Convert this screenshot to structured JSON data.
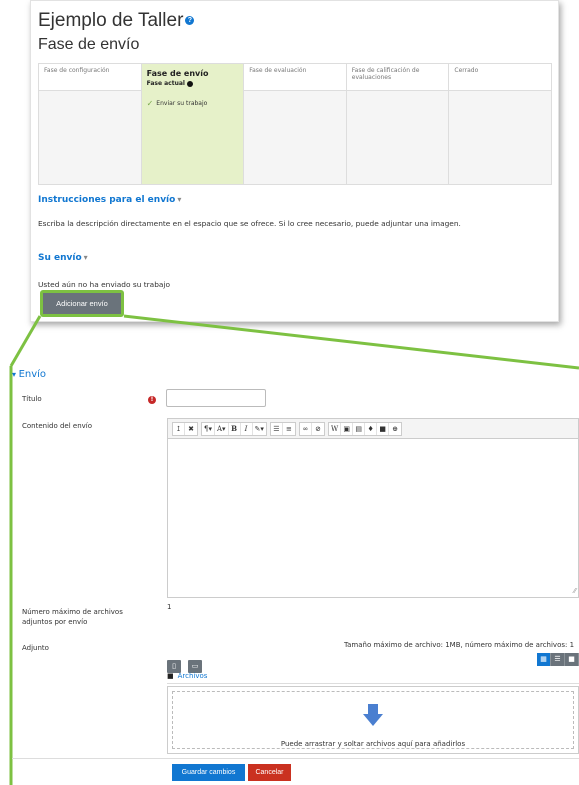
{
  "header": {
    "title": "Ejemplo de Taller",
    "help_glyph": "?",
    "phase_title": "Fase de envío"
  },
  "phases": [
    {
      "name": "Fase de configuración",
      "active": false
    },
    {
      "name": "Fase de envío",
      "active": true,
      "current_label": "Fase actual",
      "tasks": [
        "Enviar su trabajo"
      ]
    },
    {
      "name": "Fase de evaluación",
      "active": false
    },
    {
      "name": "Fase de calificación de evaluaciones",
      "active": false
    },
    {
      "name": "Cerrado",
      "active": false
    }
  ],
  "instructions": {
    "heading": "Instrucciones para el envío",
    "text": "Escriba la descripción directamente en el espacio que se ofrece. Si lo cree necesario, puede adjuntar una imagen."
  },
  "submission": {
    "heading": "Su envío",
    "status_text": "Usted aún no ha enviado su trabajo",
    "add_button": "Adicionar envío"
  },
  "form": {
    "legend": "Envío",
    "title_label": "Título",
    "title_value": "",
    "content_label": "Contenido del envío",
    "max_files_label": "Número máximo de archivos adjuntos por envío",
    "max_files_value": "1",
    "attachment_label": "Adjunto",
    "limits_text": "Tamaño máximo de archivo: 1MB, número máximo de archivos: 1",
    "files_path": "Archivos",
    "drop_text": "Puede arrastrar y soltar archivos aquí para añadirlos",
    "save_button": "Guardar cambios",
    "cancel_button": "Cancelar"
  },
  "colors": {
    "accent": "#1177d1",
    "highlight": "#7dc142",
    "active_phase": "#e6f1c9",
    "cancel": "#ca3120"
  }
}
